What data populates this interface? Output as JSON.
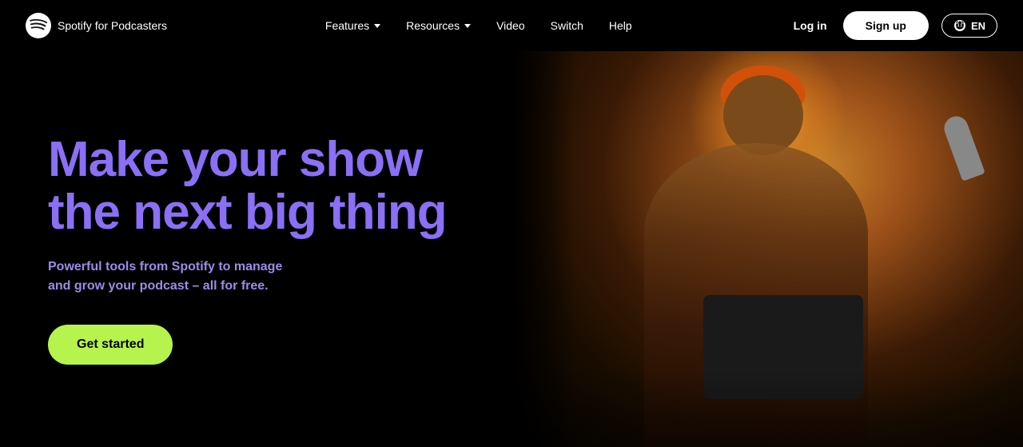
{
  "logo": {
    "brand": "Spotify",
    "suffix": " for Podcasters",
    "icon_alt": "spotify-logo"
  },
  "nav": {
    "links": [
      {
        "label": "Features",
        "has_dropdown": true
      },
      {
        "label": "Resources",
        "has_dropdown": true
      },
      {
        "label": "Video",
        "has_dropdown": false
      },
      {
        "label": "Switch",
        "has_dropdown": false
      },
      {
        "label": "Help",
        "has_dropdown": false
      }
    ],
    "login_label": "Log in",
    "signup_label": "Sign up",
    "lang_label": "EN"
  },
  "hero": {
    "title_line1": "Make your show",
    "title_line2": "the next big thing",
    "subtitle": "Powerful tools from Spotify to manage\nand grow your podcast – all for free.",
    "cta_label": "Get started"
  }
}
